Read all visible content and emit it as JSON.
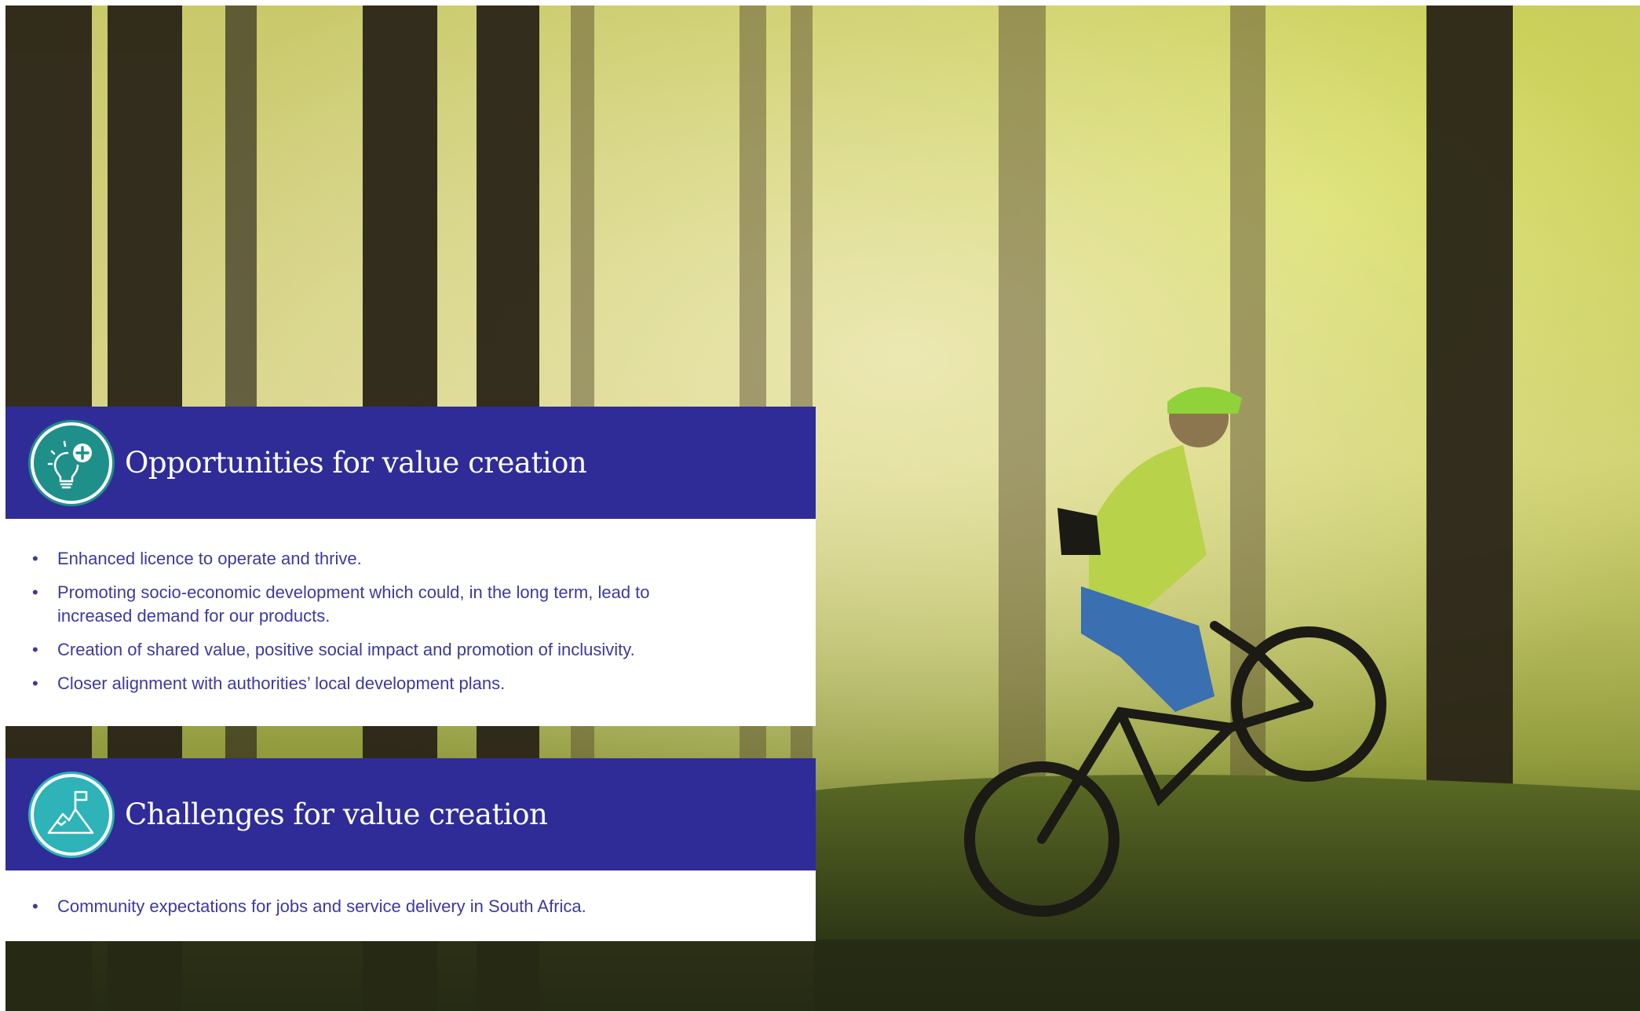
{
  "photo": {
    "description_icon": "mountain-bike-forest-photo"
  },
  "opportunities": {
    "icon": "lightbulb-plus-icon",
    "icon_color": "#1f8f8a",
    "title": "Opportunities for value creation",
    "items": [
      "Enhanced licence to operate and thrive.",
      "Promoting socio-economic development which could, in the long term, lead to increased demand for our products.",
      "Creation of shared value, positive social impact and promotion of inclusivity.",
      "Closer alignment with authorities’ local development plans."
    ]
  },
  "challenges": {
    "icon": "mountain-flag-icon",
    "icon_color": "#2db3b8",
    "title": "Challenges for value creation",
    "items": [
      "Community expectations for jobs and service delivery in South Africa."
    ]
  },
  "colors": {
    "header_bg": "#2f2c98",
    "text": "#3b3aa0"
  }
}
